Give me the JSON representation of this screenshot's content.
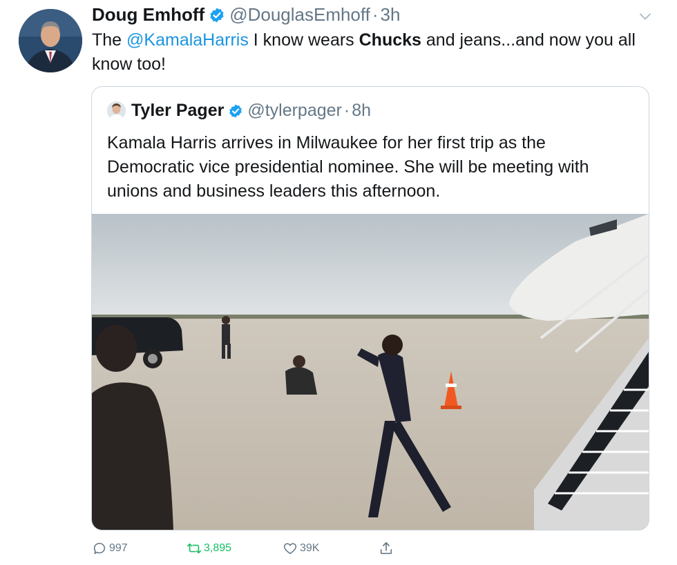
{
  "tweet": {
    "display_name": "Doug Emhoff",
    "handle": "@DouglasEmhoff",
    "separator": "·",
    "time": "3h",
    "text_parts": {
      "p1": "The ",
      "mention": "@KamalaHarris",
      "p2": " I know wears ",
      "bold": "Chucks",
      "p3": " and jeans...and now you all know too!"
    }
  },
  "quote": {
    "display_name": "Tyler Pager",
    "handle": "@tylerpager",
    "separator": "·",
    "time": "8h",
    "text": "Kamala Harris arrives in Milwaukee for her first trip as the Democratic vice presidential nominee. She will be meeting with unions and business leaders this afternoon."
  },
  "actions": {
    "replies": "997",
    "retweets": "3,895",
    "likes": "39K"
  },
  "colors": {
    "link": "#1b95e0",
    "verified": "#1da1f2",
    "retweet": "#17bf63",
    "muted": "#657786"
  },
  "icons": {
    "verified": "verified-badge-icon",
    "caret": "chevron-down-icon",
    "reply": "reply-icon",
    "retweet": "retweet-icon",
    "like": "heart-icon",
    "share": "share-icon"
  }
}
